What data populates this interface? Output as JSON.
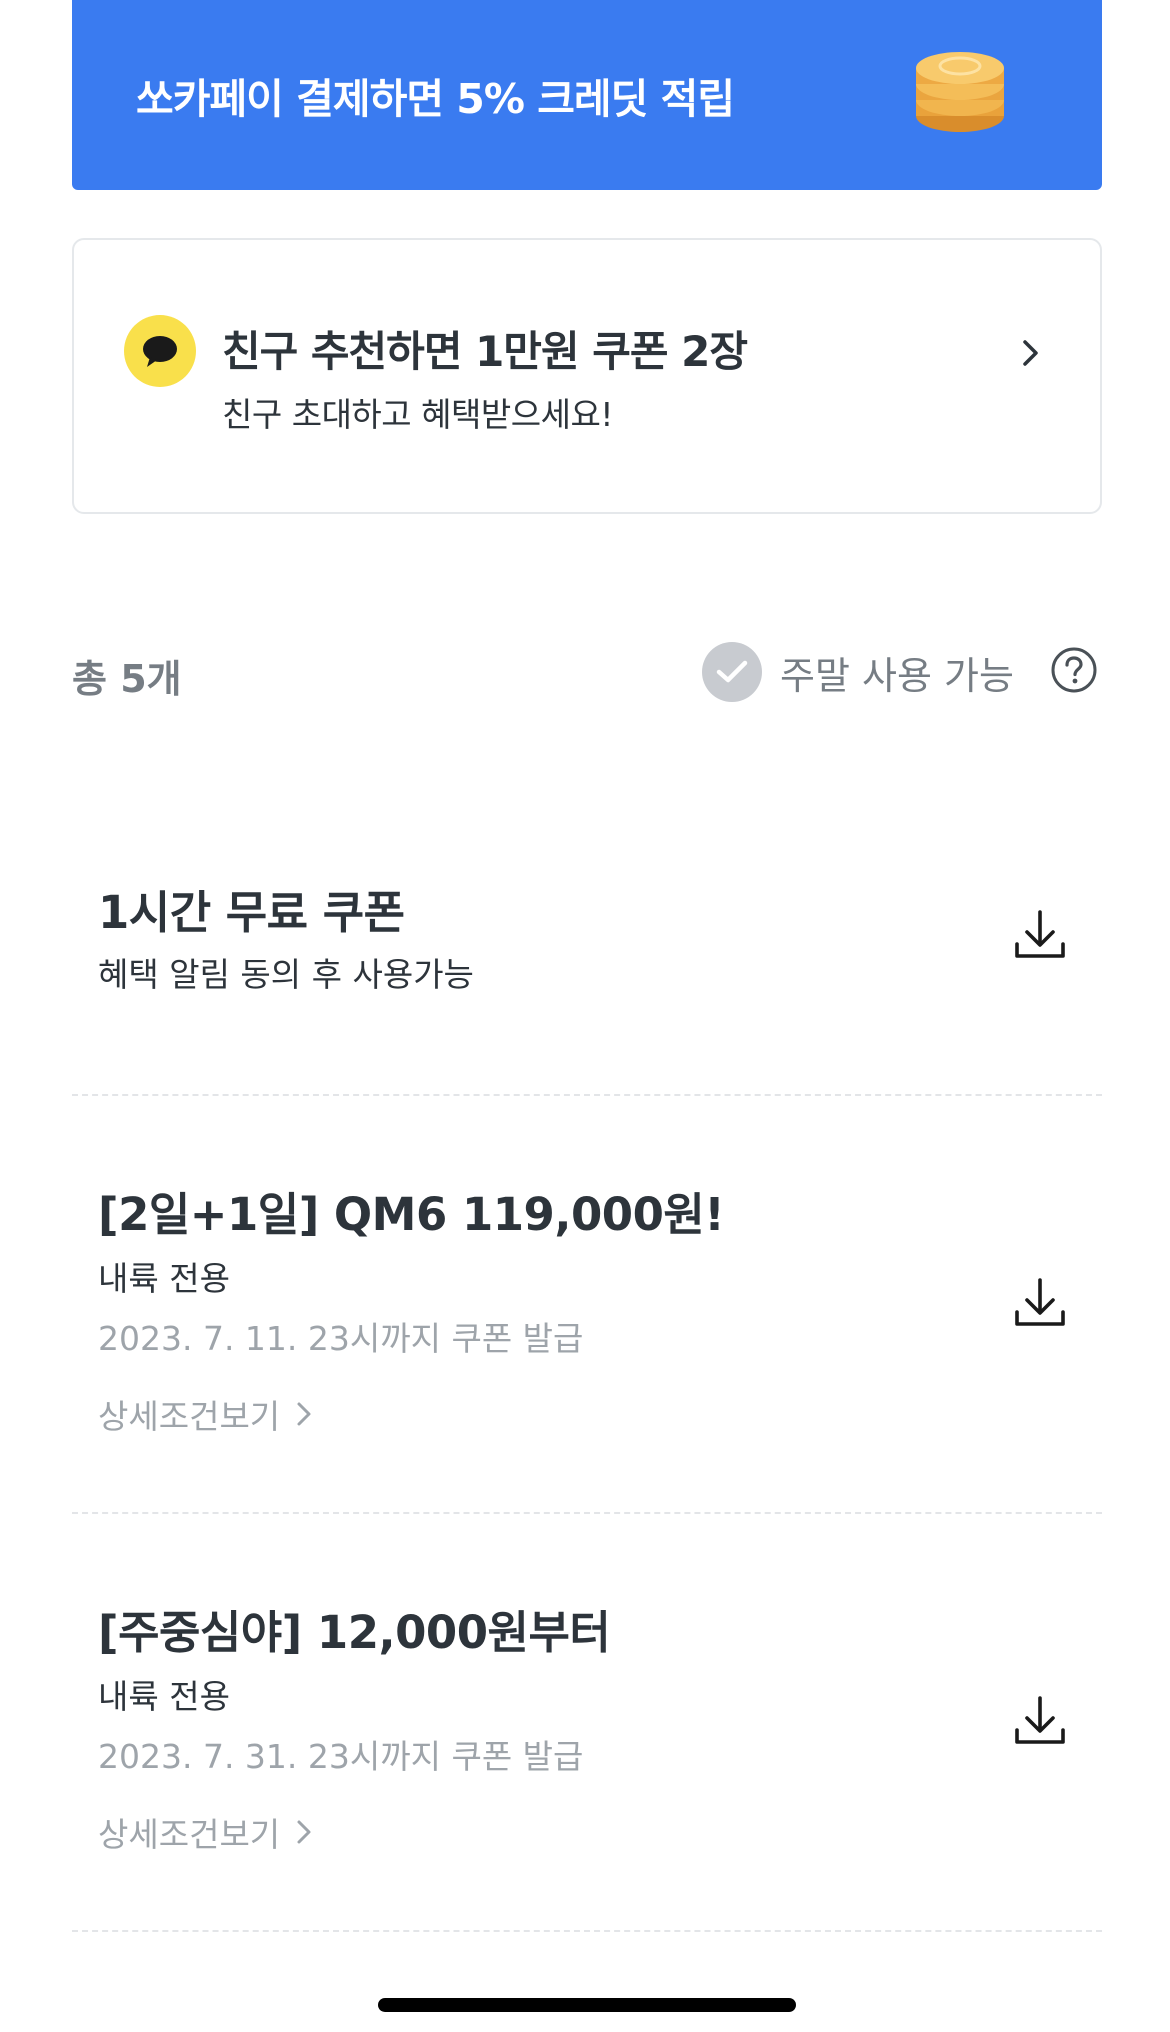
{
  "banner": {
    "text": "쏘카페이 결제하면 5% 크레딧 적립",
    "icon": "coin-stack-icon",
    "background": "#3a7bf0"
  },
  "invite": {
    "icon": "kakaotalk-icon",
    "title": "친구 추천하면 1만원 쿠폰 2장",
    "subtitle": "친구 초대하고 혜택받으세요!"
  },
  "filter": {
    "count_label": "총 5개",
    "weekend_label": "주말 사용 가능",
    "weekend_checked": false
  },
  "coupons": [
    {
      "title": "1시간 무료 쿠폰",
      "desc": "혜택 알림 동의 후 사용가능"
    },
    {
      "title": "[2일+1일] QM6 119,000원!",
      "desc": "내륙 전용",
      "date": "2023. 7. 11. 23시까지 쿠폰 발급",
      "detail": "상세조건보기"
    },
    {
      "title": "[주중심야] 12,000원부터",
      "desc": "내륙 전용",
      "date": "2023. 7. 31. 23시까지 쿠폰 발급",
      "detail": "상세조건보기"
    }
  ]
}
